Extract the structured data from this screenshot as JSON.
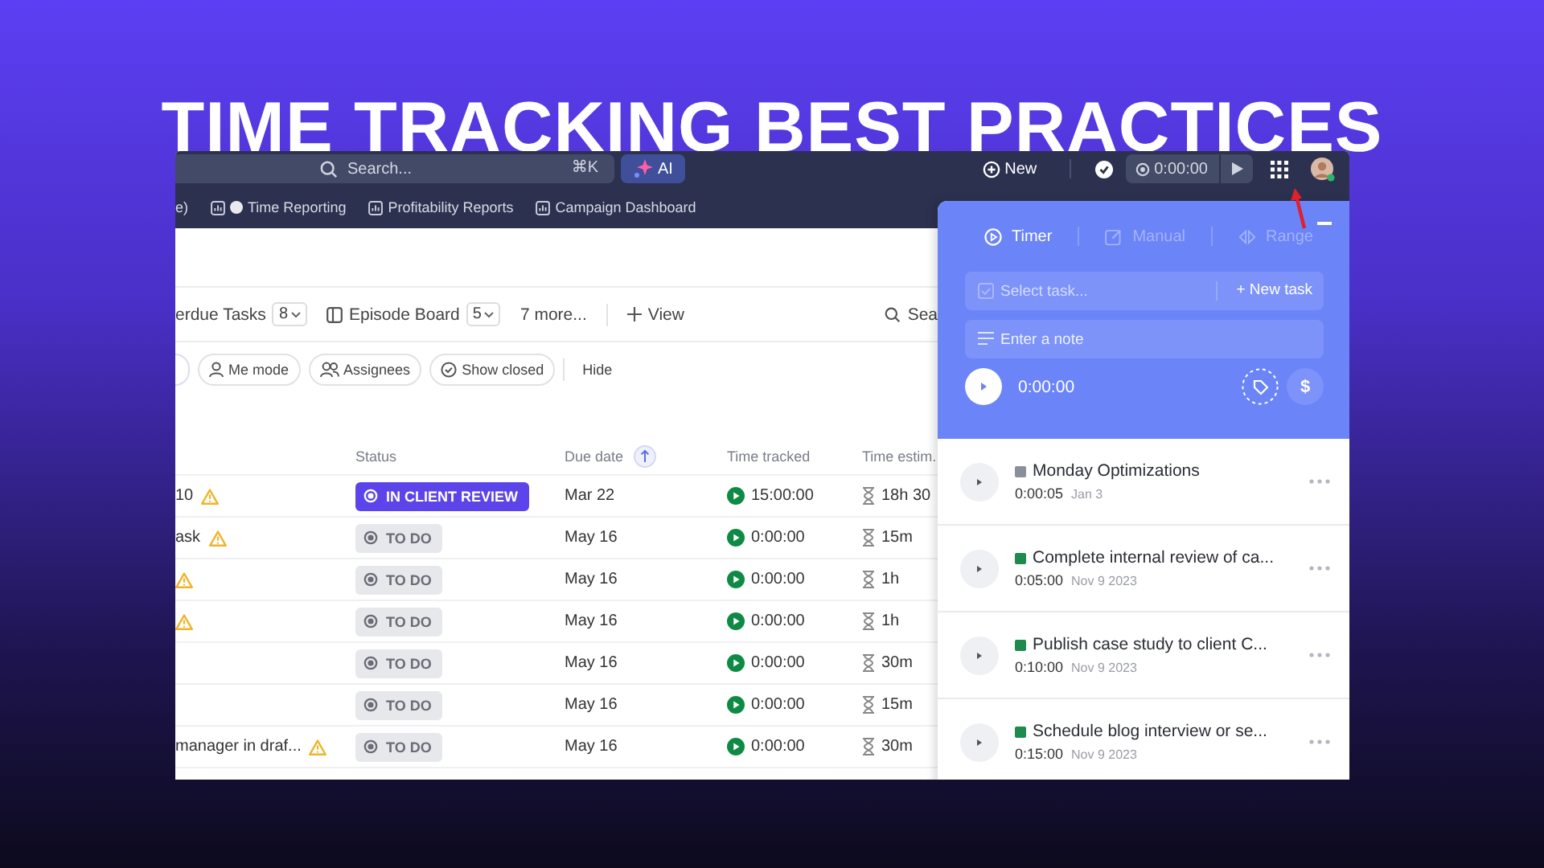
{
  "headline": "TIME TRACKING BEST PRACTICES",
  "top_bar": {
    "search_placeholder": "Search...",
    "shortcut": "⌘K",
    "ai_button": "AI",
    "new_button": "New",
    "timer": "0:00:00"
  },
  "bookmark_cut": "e)",
  "bookmarks": [
    "Time Reporting",
    "Profitability Reports",
    "Campaign Dashboard"
  ],
  "views": [
    {
      "label": "erdue Tasks",
      "count": "8"
    },
    {
      "label": "Episode Board",
      "count": "5"
    }
  ],
  "more_views": "7 more...",
  "add_view": "View",
  "search_cut": "Sea",
  "filters": [
    "Me mode",
    "Assignees",
    "Show closed"
  ],
  "hide": "Hide",
  "table": {
    "columns": [
      "Status",
      "Due date",
      "Time tracked",
      "Time estim."
    ],
    "rows": [
      {
        "name": "10",
        "warning": true,
        "status": "IN CLIENT REVIEW",
        "kind": "review",
        "due": "Mar 22",
        "tracked": "15:00:00",
        "estimate": "18h 30"
      },
      {
        "name": "ask",
        "warning": true,
        "status": "TO DO",
        "kind": "todo",
        "due": "May 16",
        "tracked": "0:00:00",
        "estimate": "15m"
      },
      {
        "warning": true,
        "status": "TO DO",
        "kind": "todo",
        "due": "May 16",
        "tracked": "0:00:00",
        "estimate": "1h"
      },
      {
        "warning": true,
        "status": "TO DO",
        "kind": "todo",
        "due": "May 16",
        "tracked": "0:00:00",
        "estimate": "1h"
      },
      {
        "warning": false,
        "status": "TO DO",
        "kind": "todo",
        "due": "May 16",
        "tracked": "0:00:00",
        "estimate": "30m"
      },
      {
        "warning": false,
        "status": "TO DO",
        "kind": "todo",
        "due": "May 16",
        "tracked": "0:00:00",
        "estimate": "15m"
      },
      {
        "name": "manager in draf...",
        "warning": true,
        "status": "TO DO",
        "kind": "todo",
        "due": "May 16",
        "tracked": "0:00:00",
        "estimate": "30m"
      }
    ]
  },
  "timer_panel": {
    "tabs": [
      {
        "label": "Timer",
        "selected": true
      },
      {
        "label": "Manual",
        "selected": false
      },
      {
        "label": "Range",
        "selected": false
      }
    ],
    "task_placeholder": "Select task...",
    "new_task": "+ New task",
    "note_placeholder": "Enter a note",
    "elapsed": "0:00:00",
    "billable": "$",
    "entries": [
      {
        "title": "Monday Optimizations",
        "color": "#8a8f9c",
        "duration": "0:00:05",
        "date": "Jan 3"
      },
      {
        "title": "Complete internal review of ca...",
        "color": "#1e8a4c",
        "duration": "0:05:00",
        "date": "Nov 9 2023"
      },
      {
        "title": "Publish case study to client C...",
        "color": "#1e8a4c",
        "duration": "0:10:00",
        "date": "Nov 9 2023"
      },
      {
        "title": "Schedule blog interview or se...",
        "color": "#1e8a4c",
        "duration": "0:15:00",
        "date": "Nov 9 2023"
      }
    ]
  }
}
